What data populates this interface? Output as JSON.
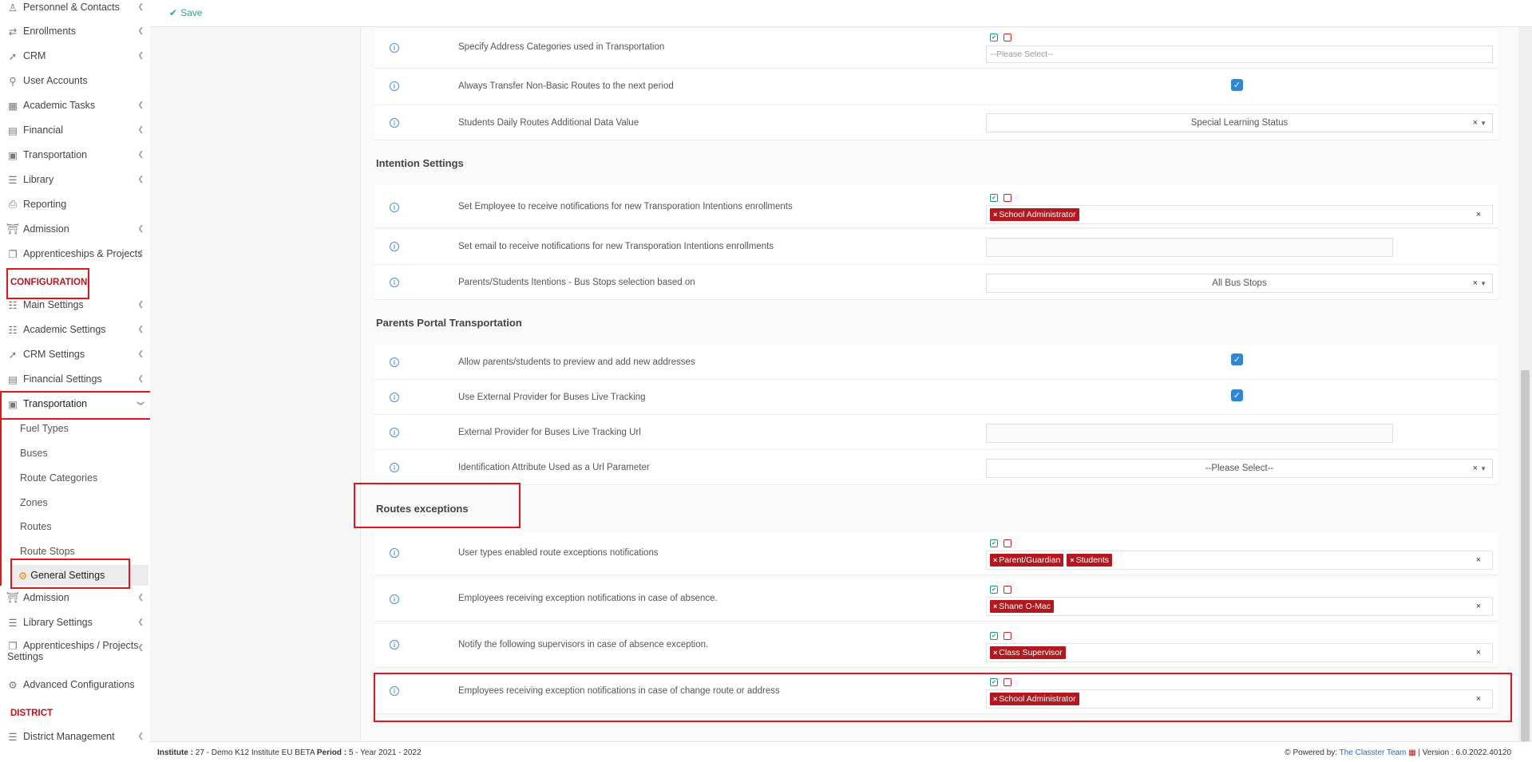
{
  "sidebar": {
    "items": [
      {
        "label": "Personnel & Contacts",
        "icon": "people-icon"
      },
      {
        "label": "Enrollments",
        "icon": "exchange-icon"
      },
      {
        "label": "CRM",
        "icon": "trend-icon"
      },
      {
        "label": "User Accounts",
        "icon": "key-icon"
      },
      {
        "label": "Academic Tasks",
        "icon": "grid-icon"
      },
      {
        "label": "Financial",
        "icon": "money-icon"
      },
      {
        "label": "Transportation",
        "icon": "bus-icon"
      },
      {
        "label": "Library",
        "icon": "books-icon"
      },
      {
        "label": "Reporting",
        "icon": "print-icon"
      },
      {
        "label": "Admission",
        "icon": "building-icon"
      },
      {
        "label": "Apprenticeships & Projects",
        "icon": "cube-icon"
      }
    ],
    "config_heading": "CONFIGURATION",
    "config_items": [
      {
        "label": "Main Settings",
        "icon": "sliders-icon"
      },
      {
        "label": "Academic Settings",
        "icon": "sitemap-icon"
      },
      {
        "label": "CRM Settings",
        "icon": "trend-icon"
      },
      {
        "label": "Financial Settings",
        "icon": "money-icon"
      },
      {
        "label": "Transportation",
        "icon": "bus-icon"
      }
    ],
    "transport_sub": [
      "Fuel Types",
      "Buses",
      "Route Categories",
      "Zones",
      "Routes",
      "Route Stops",
      "General Settings"
    ],
    "config_items2": [
      {
        "label": "Admission",
        "icon": "building-icon"
      },
      {
        "label": "Library Settings",
        "icon": "books-icon"
      },
      {
        "label": "Apprenticeships / Projects",
        "label2": "Settings",
        "icon": "cube-icon"
      },
      {
        "label": "Advanced Configurations",
        "icon": "gears-icon"
      }
    ],
    "district_heading": "DISTRICT",
    "district_items": [
      {
        "label": "District Management",
        "icon": "list-icon"
      }
    ]
  },
  "toolbar": {
    "save_label": "Save"
  },
  "rows": {
    "r1": {
      "label": "Specify Address Categories used in Transportation",
      "placeholder": "--Please Select--"
    },
    "r2": {
      "label": "Always Transfer Non-Basic Routes to the next period"
    },
    "r3": {
      "label": "Students Daily Routes Additional Data Value",
      "value": "Special Learning Status"
    },
    "s_intention": "Intention Settings",
    "r4": {
      "label": "Set Employee to receive notifications for new Transporation Intentions enrollments",
      "tags": [
        "School Administrator"
      ]
    },
    "r5": {
      "label": "Set email to receive notifications for new Transporation Intentions enrollments"
    },
    "r6": {
      "label": "Parents/Students Itentions - Bus Stops selection based on",
      "value": "All Bus Stops"
    },
    "s_portal": "Parents Portal Transportation",
    "r7": {
      "label": "Allow parents/students to preview and add new addresses"
    },
    "r8": {
      "label": "Use External Provider for Buses Live Tracking"
    },
    "r9": {
      "label": "External Provider for Buses Live Tracking Url"
    },
    "r10": {
      "label": "Identification Attribute Used as a Url Parameter",
      "value": "--Please Select--"
    },
    "s_routes": "Routes exceptions",
    "r11": {
      "label": "User types enabled route exceptions notifications",
      "tags": [
        "Parent/Guardian",
        "Students"
      ]
    },
    "r12": {
      "label": "Employees receiving exception notifications in case of absence.",
      "tags": [
        "Shane O-Mac"
      ]
    },
    "r13": {
      "label": "Notify the following supervisors in case of absence exception.",
      "tags": [
        "Class Supervisor"
      ]
    },
    "r14": {
      "label": "Employees receiving exception notifications in case of change route or address",
      "tags": [
        "School Administrator"
      ]
    }
  },
  "footer": {
    "institute_label": "Institute :",
    "institute_value": "27 - Demo K12 Institute EU BETA",
    "period_label": "Period :",
    "period_value": "5 - Year 2021 - 2022",
    "powered": "Powered by:",
    "team": "The Classter Team",
    "version": "| Version : 6.0.2022.40120"
  },
  "colors": {
    "accent": "#27a59a",
    "brand_red": "#b5171f",
    "highlight": "#e2141c",
    "checkbox": "#2f86d4"
  }
}
